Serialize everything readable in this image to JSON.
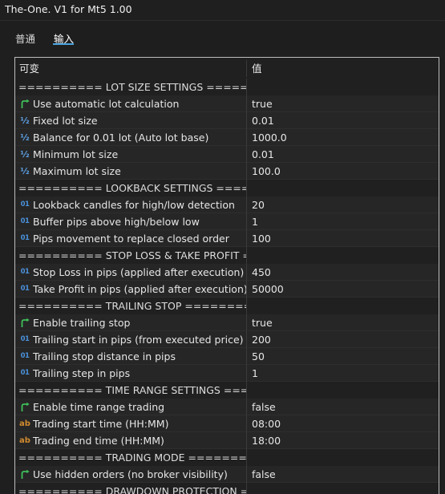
{
  "window": {
    "title": "The-One. V1 for Mt5 1.00"
  },
  "tabs": [
    {
      "label": "普通"
    },
    {
      "label": "输入"
    }
  ],
  "table": {
    "header": {
      "variable": "可变",
      "value": "值"
    },
    "rows": [
      {
        "kind": "section",
        "label": "========== LOT SIZE SETTINGS =======..."
      },
      {
        "kind": "param",
        "icon": "bool-arrow-icon",
        "label": "Use automatic lot calculation",
        "value": "true"
      },
      {
        "kind": "param",
        "icon": "fraction-icon",
        "label": "Fixed lot size",
        "value": "0.01"
      },
      {
        "kind": "param",
        "icon": "fraction-icon",
        "label": "Balance for 0.01 lot (Auto lot base)",
        "value": "1000.0"
      },
      {
        "kind": "param",
        "icon": "fraction-icon",
        "label": "Minimum lot size",
        "value": "0.01"
      },
      {
        "kind": "param",
        "icon": "fraction-icon",
        "label": "Maximum lot size",
        "value": "100.0"
      },
      {
        "kind": "section",
        "label": "========== LOOKBACK SETTINGS ======..."
      },
      {
        "kind": "param",
        "icon": "integer-icon",
        "label": "Lookback candles for high/low detection",
        "value": "20"
      },
      {
        "kind": "param",
        "icon": "integer-icon",
        "label": "Buffer pips above high/below low",
        "value": "1"
      },
      {
        "kind": "param",
        "icon": "integer-icon",
        "label": "Pips movement to replace closed order",
        "value": "100"
      },
      {
        "kind": "section",
        "label": "========== STOP LOSS & TAKE PROFIT ==..."
      },
      {
        "kind": "param",
        "icon": "integer-icon",
        "label": "Stop Loss in pips (applied after execution)",
        "value": "450"
      },
      {
        "kind": "param",
        "icon": "integer-icon",
        "label": "Take Profit in pips (applied after execution)",
        "value": "50000"
      },
      {
        "kind": "section",
        "label": "========== TRAILING STOP =========="
      },
      {
        "kind": "param",
        "icon": "bool-arrow-icon",
        "label": "Enable trailing stop",
        "value": "true"
      },
      {
        "kind": "param",
        "icon": "integer-icon",
        "label": "Trailing start in pips (from executed price)",
        "value": "200"
      },
      {
        "kind": "param",
        "icon": "integer-icon",
        "label": "Trailing stop distance in pips",
        "value": "50"
      },
      {
        "kind": "param",
        "icon": "integer-icon",
        "label": "Trailing step in pips",
        "value": "1"
      },
      {
        "kind": "section",
        "label": "========== TIME RANGE SETTINGS ====..."
      },
      {
        "kind": "param",
        "icon": "bool-arrow-icon",
        "label": "Enable time range trading",
        "value": "false"
      },
      {
        "kind": "param",
        "icon": "string-icon",
        "label": "Trading start time (HH:MM)",
        "value": "08:00"
      },
      {
        "kind": "param",
        "icon": "string-icon",
        "label": "Trading end time (HH:MM)",
        "value": "18:00"
      },
      {
        "kind": "section",
        "label": "========== TRADING MODE ========..."
      },
      {
        "kind": "param",
        "icon": "bool-arrow-icon",
        "label": "Use hidden orders (no broker visibility)",
        "value": "false"
      },
      {
        "kind": "section",
        "label": "========== DRAWDOWN PROTECTION =="
      }
    ]
  }
}
